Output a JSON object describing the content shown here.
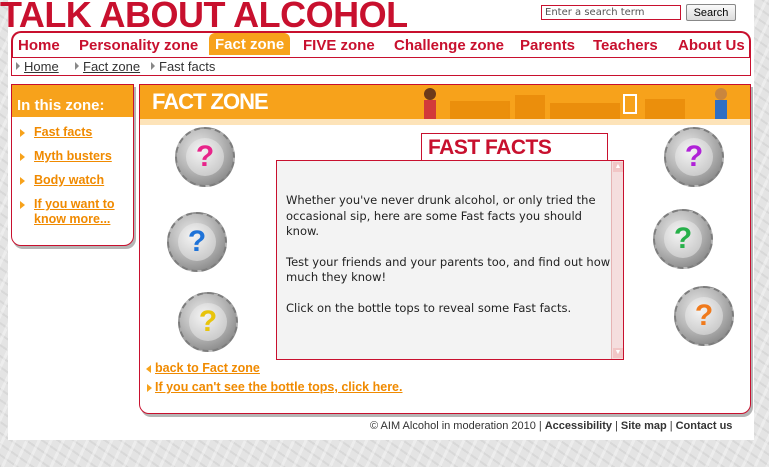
{
  "site": {
    "title": "TALK ABOUT ALCOHOL"
  },
  "search": {
    "placeholder": "Enter a search term",
    "button_label": "Search"
  },
  "nav": {
    "items": [
      {
        "label": "Home"
      },
      {
        "label": "Personality zone"
      },
      {
        "label": "Fact zone",
        "active": true
      },
      {
        "label": "FIVE zone"
      },
      {
        "label": "Challenge zone"
      },
      {
        "label": "Parents"
      },
      {
        "label": "Teachers"
      },
      {
        "label": "About Us"
      }
    ]
  },
  "breadcrumb": {
    "home": "Home",
    "zone": "Fact zone",
    "current": "Fast facts"
  },
  "sidebar": {
    "heading": "In this zone:",
    "links": [
      {
        "label": "Fast facts"
      },
      {
        "label": "Myth busters"
      },
      {
        "label": "Body watch"
      },
      {
        "label_line1": "If you want to",
        "label_line2": "know more..."
      }
    ]
  },
  "banner": {
    "title": "FACT ZONE"
  },
  "fast_facts": {
    "title": "FAST FACTS",
    "paragraphs": [
      "Whether you've never drunk alcohol, or only tried the occasional sip, here are some Fast facts you should know.",
      "Test your friends and your parents too, and find out how much they know!",
      "Click on the bottle tops to reveal some Fast facts."
    ]
  },
  "bottle_tops": {
    "symbol": "?",
    "colors": [
      "#e8248a",
      "#1f73d8",
      "#e8c40c",
      "#b022d8",
      "#27b04a",
      "#f07a1c"
    ]
  },
  "links": {
    "back": "back to Fact zone",
    "bottle_tops_help": "If you can't see the bottle tops, click here."
  },
  "footer": {
    "copyright": "© AIM Alcohol in moderation 2010",
    "accessibility": "Accessibility",
    "site_map": "Site map",
    "contact": "Contact us",
    "separator": "|"
  },
  "colors": {
    "brand_red": "#c8102e",
    "accent_orange": "#f7a21b",
    "link_orange": "#f08a00"
  }
}
